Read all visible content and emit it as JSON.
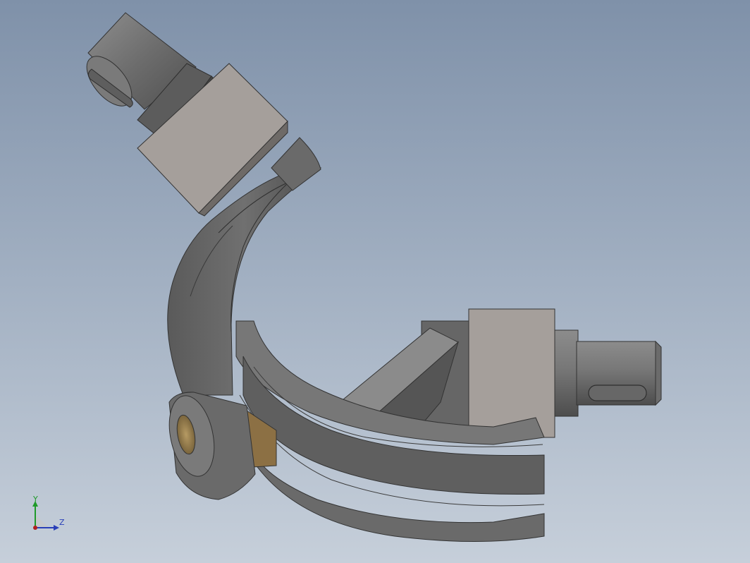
{
  "viewport": {
    "background_top": "#7f91a9",
    "background_bottom": "#c6cfda"
  },
  "model": {
    "shading_dark": "#4e4e4e",
    "shading_mid": "#6b6b6b",
    "shading_light": "#8a8a8a",
    "block_face": "#a59f9b",
    "bushing_color": "#a08657"
  },
  "triad": {
    "y_label": "Y",
    "z_label": "Z",
    "y_color": "#1f9a2a",
    "z_color": "#2a3fb8"
  }
}
